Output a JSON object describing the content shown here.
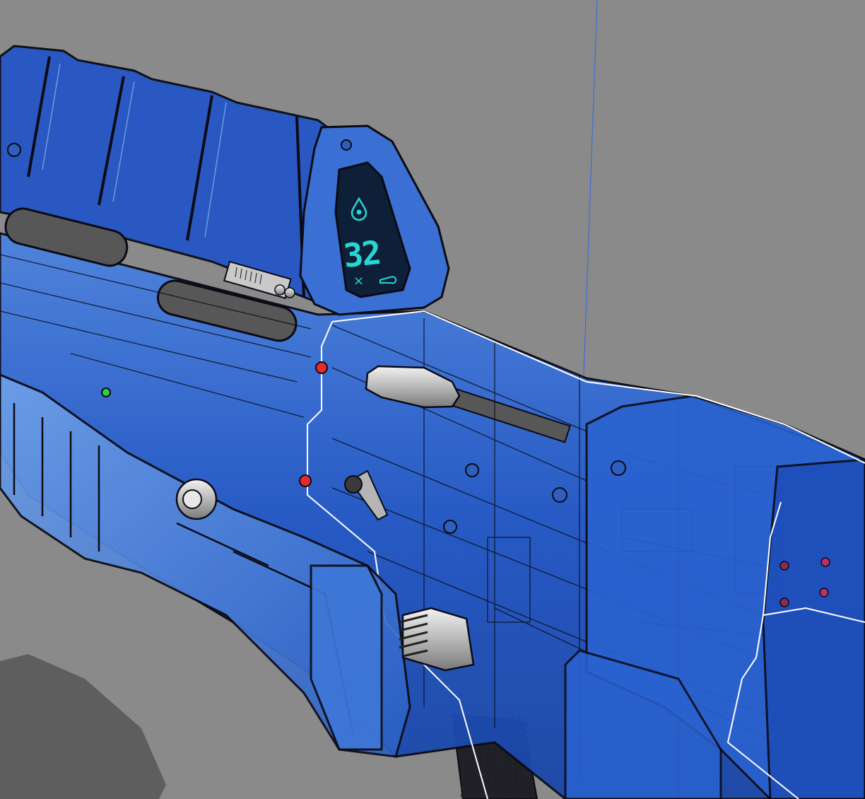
{
  "scene": {
    "subject": "rifle-model",
    "render_style": "translucent-blue-xray",
    "colors": {
      "background": "#8a8a8a",
      "body_fill": "#1f55c8",
      "body_fill_light": "#5b8fe0",
      "outline": "#0a0a14",
      "edge_highlight": "#ffffff",
      "display_bg": "#0e2038",
      "display_glyph": "#27d6d6",
      "metal": "#bdbdbd",
      "screw_red": "#e52b2b",
      "screw_green": "#2bd23c",
      "shadow": "#5e5e5e",
      "axis_line": "#3b6fd9"
    }
  },
  "ammo_display": {
    "count": "32",
    "multiplier": "×",
    "icons": [
      "water-drop-icon",
      "bullet-icon"
    ]
  }
}
